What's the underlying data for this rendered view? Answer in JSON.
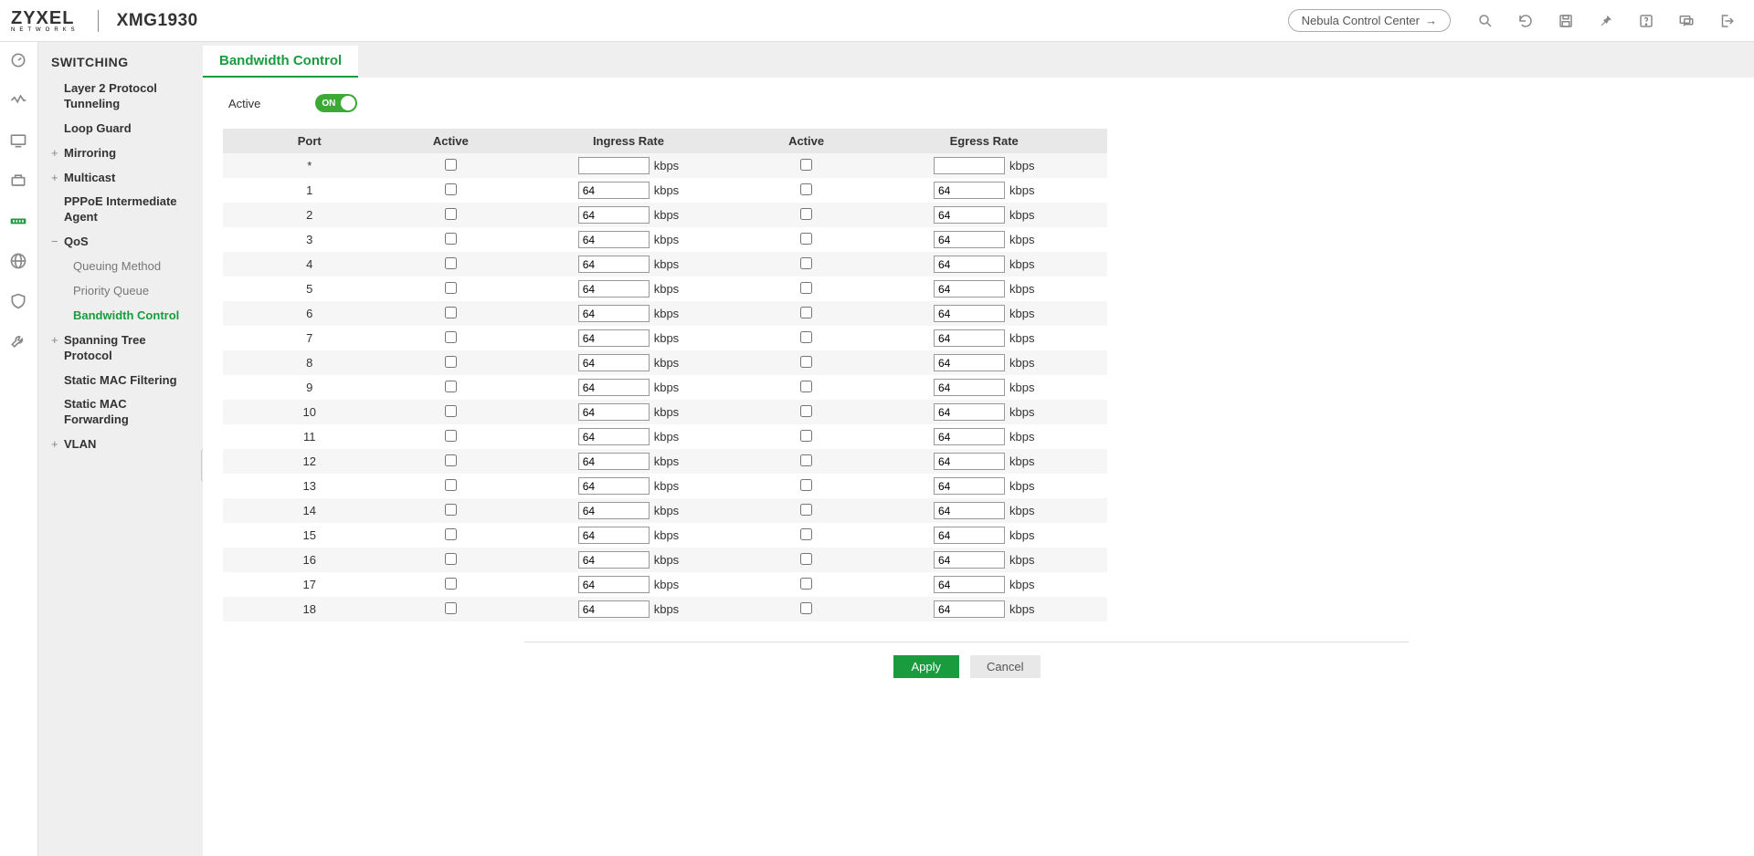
{
  "header": {
    "brand_top": "ZYXEL",
    "brand_sub": "NETWORKS",
    "model": "XMG1930",
    "nebula_label": "Nebula Control Center"
  },
  "sidebar": {
    "title": "SWITCHING",
    "items": {
      "l2pt": "Layer 2 Protocol Tunneling",
      "loopguard": "Loop Guard",
      "mirroring": "Mirroring",
      "multicast": "Multicast",
      "pppoe": "PPPoE Intermediate Agent",
      "qos": "QoS",
      "queuing": "Queuing Method",
      "priority": "Priority Queue",
      "bandwidth": "Bandwidth Control",
      "stp": "Spanning Tree Protocol",
      "smf": "Static MAC Filtering",
      "smfw": "Static MAC Forwarding",
      "vlan": "VLAN"
    }
  },
  "page": {
    "tab": "Bandwidth Control",
    "active_label": "Active",
    "toggle_state": "ON",
    "columns": {
      "port": "Port",
      "active_in": "Active",
      "ingress": "Ingress Rate",
      "active_eg": "Active",
      "egress": "Egress Rate"
    },
    "unit": "kbps",
    "rows": [
      {
        "port": "*",
        "ingress": "",
        "egress": ""
      },
      {
        "port": "1",
        "ingress": "64",
        "egress": "64"
      },
      {
        "port": "2",
        "ingress": "64",
        "egress": "64"
      },
      {
        "port": "3",
        "ingress": "64",
        "egress": "64"
      },
      {
        "port": "4",
        "ingress": "64",
        "egress": "64"
      },
      {
        "port": "5",
        "ingress": "64",
        "egress": "64"
      },
      {
        "port": "6",
        "ingress": "64",
        "egress": "64"
      },
      {
        "port": "7",
        "ingress": "64",
        "egress": "64"
      },
      {
        "port": "8",
        "ingress": "64",
        "egress": "64"
      },
      {
        "port": "9",
        "ingress": "64",
        "egress": "64"
      },
      {
        "port": "10",
        "ingress": "64",
        "egress": "64"
      },
      {
        "port": "11",
        "ingress": "64",
        "egress": "64"
      },
      {
        "port": "12",
        "ingress": "64",
        "egress": "64"
      },
      {
        "port": "13",
        "ingress": "64",
        "egress": "64"
      },
      {
        "port": "14",
        "ingress": "64",
        "egress": "64"
      },
      {
        "port": "15",
        "ingress": "64",
        "egress": "64"
      },
      {
        "port": "16",
        "ingress": "64",
        "egress": "64"
      },
      {
        "port": "17",
        "ingress": "64",
        "egress": "64"
      },
      {
        "port": "18",
        "ingress": "64",
        "egress": "64"
      }
    ],
    "buttons": {
      "apply": "Apply",
      "cancel": "Cancel"
    }
  }
}
